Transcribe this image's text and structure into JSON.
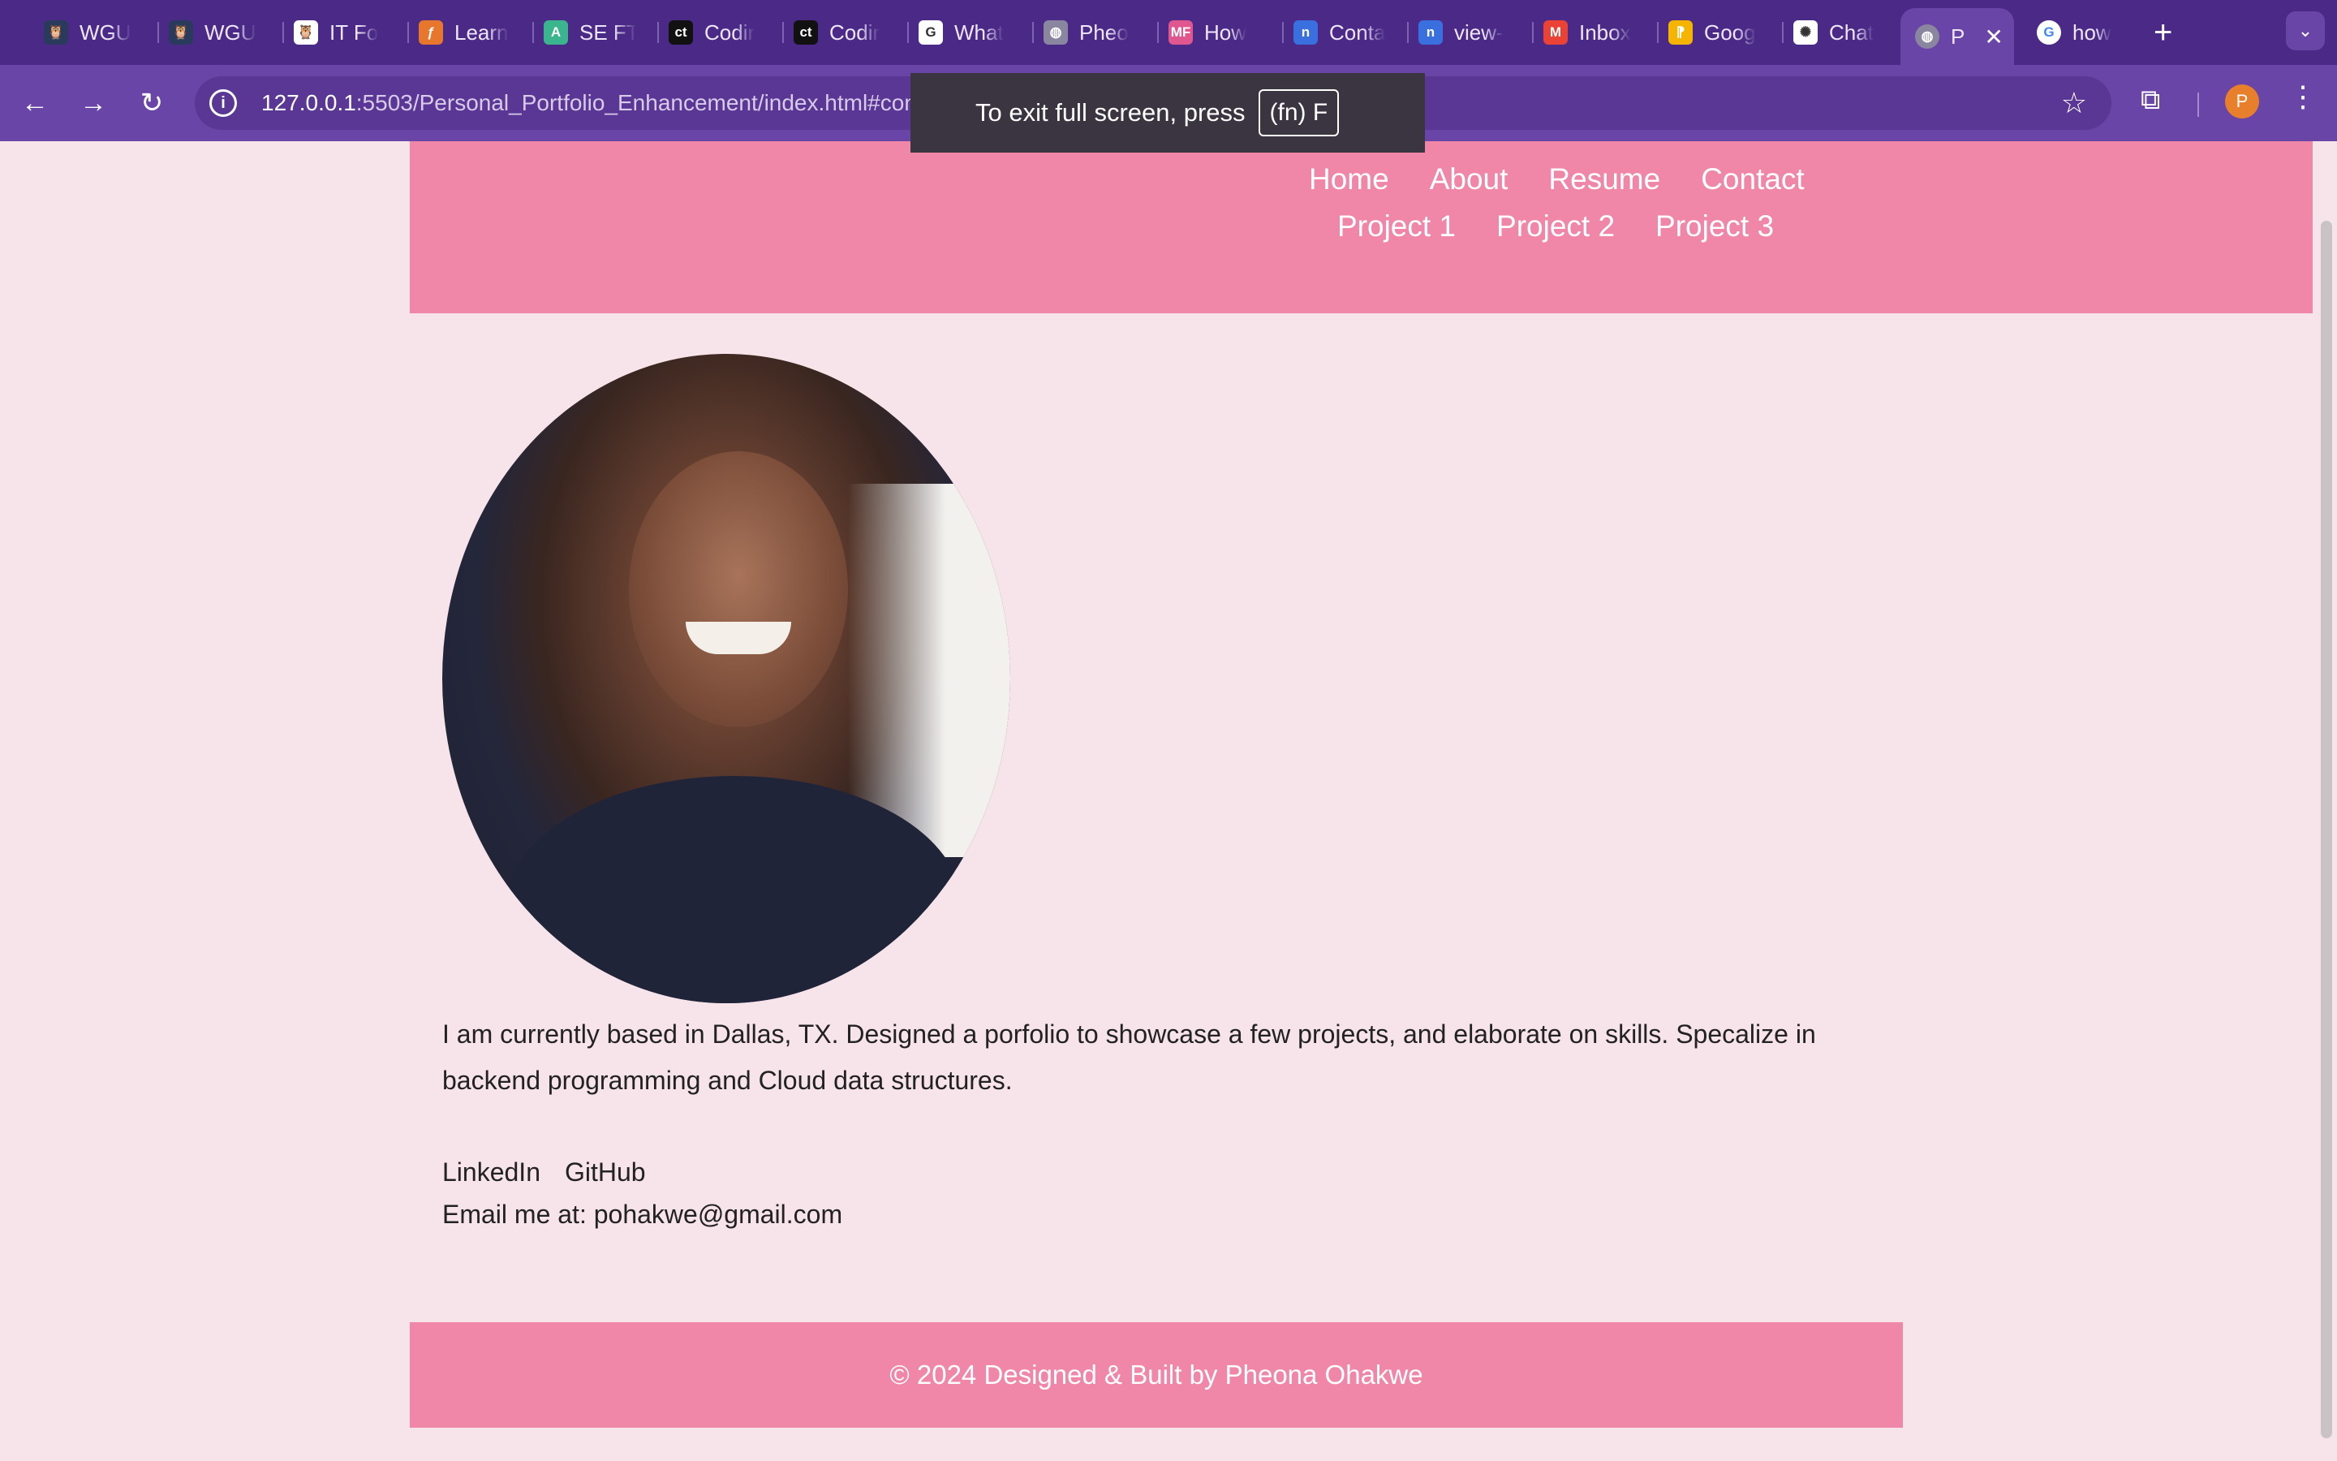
{
  "browser": {
    "tabs": [
      {
        "title": "WGU",
        "icon": "owl-icon",
        "color": "#2a3a5c"
      },
      {
        "title": "WGU",
        "icon": "owl-icon",
        "color": "#2a3a5c"
      },
      {
        "title": "IT Fo",
        "icon": "owl-icon",
        "color": "#ffffff"
      },
      {
        "title": "Learn",
        "icon": "flame-icon",
        "color": "#e8772e"
      },
      {
        "title": "SE FT",
        "icon": "a-icon",
        "color": "#3bb58e"
      },
      {
        "title": "Codir",
        "icon": "ct-icon",
        "color": "#111111"
      },
      {
        "title": "Codir",
        "icon": "ct-icon",
        "color": "#111111"
      },
      {
        "title": "What",
        "icon": "google-icon",
        "color": "#ffffff"
      },
      {
        "title": "Pheo",
        "icon": "globe-icon",
        "color": "#8b86a0"
      },
      {
        "title": "How",
        "icon": "mf-icon",
        "color": "#e0568e"
      },
      {
        "title": "Conta",
        "icon": "n-icon",
        "color": "#3a6fe0"
      },
      {
        "title": "view-",
        "icon": "n-icon",
        "color": "#3a6fe0"
      },
      {
        "title": "Inbox",
        "icon": "gmail-icon",
        "color": "#ea4335"
      },
      {
        "title": "Goog",
        "icon": "pin-icon",
        "color": "#f4b400"
      },
      {
        "title": "Chat",
        "icon": "openai-icon",
        "color": "#ffffff"
      }
    ],
    "active_tab": {
      "title": "P",
      "icon": "globe-icon"
    },
    "last_tab": {
      "title": "how",
      "icon": "google-icon"
    },
    "new_tab": "+",
    "url_host": "127.0.0.1",
    "url_path": ":5503/Personal_Portfolio_Enhancement/index.html#contact",
    "profile_initial": "P",
    "fullscreen_toast": {
      "text": "To exit full screen, press",
      "key": "(fn) F"
    }
  },
  "nav": {
    "row1": [
      "Home",
      "About",
      "Resume",
      "Contact"
    ],
    "row2": [
      "Project 1",
      "Project 2",
      "Project 3"
    ]
  },
  "contact": {
    "bio": "I am currently based in Dallas, TX. Designed a porfolio to showcase a few projects, and elaborate on skills. Specalize in backend programming and Cloud data structures.",
    "links": [
      "LinkedIn",
      "GitHub"
    ],
    "email": "Email me at: pohakwe@gmail.com"
  },
  "footer": {
    "text": "© 2024 Designed & Built by Pheona Ohakwe"
  },
  "colors": {
    "header_pink": "#f086a8",
    "page_bg": "#f7e4eb",
    "chrome_purple": "#4a2a86"
  }
}
